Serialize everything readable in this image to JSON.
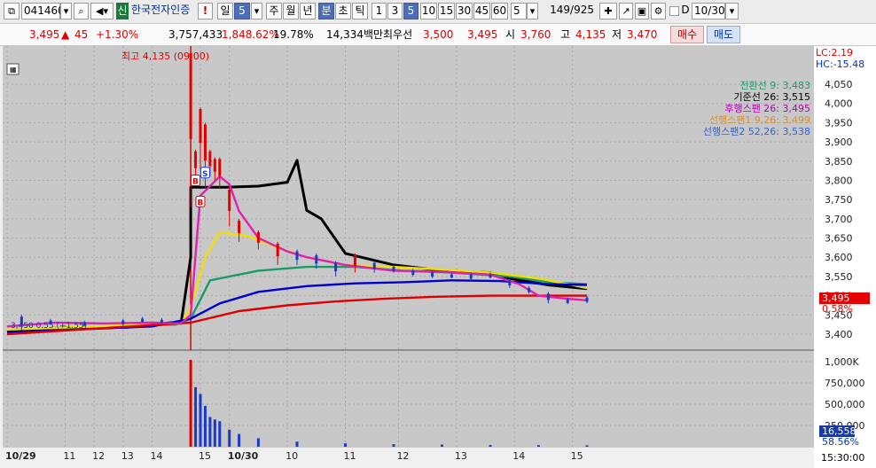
{
  "toolbar": {
    "code": "041460",
    "market_badge": "신",
    "stock_name": "한국전자인증",
    "alert_label": "!",
    "period_day": "일",
    "period_num": "5",
    "periods": [
      "주",
      "월",
      "년",
      "분",
      "초",
      "틱"
    ],
    "intervals": [
      "1",
      "3",
      "5",
      "10",
      "15",
      "30",
      "45",
      "60"
    ],
    "count_value": "5",
    "page_counter": "149/925",
    "d_label": "D",
    "date_value": "10/30",
    "colors": {
      "selected": "#4a6fb8"
    }
  },
  "info": {
    "price": "3,495",
    "change": "45",
    "change_pct": "+1.30%",
    "volume": "3,757,433",
    "vol_ratio": "1,848.62%",
    "turnover": "19.78%",
    "amount": "14,334백만",
    "bid_label": "최우선",
    "bid_price": "3,500",
    "ask_price": "3,495",
    "open_label": "시",
    "open": "3,760",
    "high_label": "고",
    "high": "4,135",
    "low_label": "저",
    "low": "3,470",
    "buy_label": "매수",
    "sell_label": "매도"
  },
  "chart": {
    "lc_label": "LC:2.19",
    "hc_label": "HC:-15.48",
    "high_annotation": "최고 4,135 (09:00)",
    "legend": [
      {
        "label": "전환선 9: 3,483",
        "color": "#1a9c66"
      },
      {
        "label": "기준선 26: 3,515",
        "color": "#000000"
      },
      {
        "label": "후행스팬 26: 3,495",
        "color": "#b000b0"
      },
      {
        "label": "선행스팬1 9,26: 3,499",
        "color": "#d89030"
      },
      {
        "label": "선행스팬2 52,26: 3,538",
        "color": "#3060d0"
      }
    ],
    "price_ticks": [
      "4,050",
      "4,000",
      "3,950",
      "3,900",
      "3,850",
      "3,800",
      "3,750",
      "3,700",
      "3,650",
      "3,600",
      "3,550",
      "3,500",
      "3,450",
      "3,400"
    ],
    "current_price_tag": "3,495",
    "current_pct_tag": "0.58%",
    "volume_ticks": [
      "1,000K",
      "750,000",
      "500,000",
      "250,000"
    ],
    "current_volume_tag": "16,558",
    "current_volume_pct": "58.56%",
    "x_labels": [
      {
        "label": "10/29"
      },
      {
        "label": "11"
      },
      {
        "label": "12"
      },
      {
        "label": "13"
      },
      {
        "label": "14"
      },
      {
        "label": "15"
      },
      {
        "label": "10/30"
      },
      {
        "label": "10"
      },
      {
        "label": "11"
      },
      {
        "label": "12"
      },
      {
        "label": "13"
      },
      {
        "label": "14"
      },
      {
        "label": "15"
      }
    ],
    "time_label": "15:30:00",
    "signals": [
      {
        "type": "B"
      },
      {
        "type": "S"
      },
      {
        "type": "B"
      }
    ],
    "small_note": "3,450 0.55 (+1.55)"
  },
  "chart_data": {
    "type": "line",
    "title": "",
    "ylim": [
      3380,
      4135
    ],
    "series": [
      {
        "name": "기준선",
        "color": "#000000",
        "points": [
          [
            0,
            3410
          ],
          [
            12,
            3417
          ],
          [
            25,
            3418
          ],
          [
            30,
            3425
          ],
          [
            34,
            3430
          ],
          [
            36,
            3428
          ],
          [
            38,
            3600
          ],
          [
            38,
            3782
          ],
          [
            45,
            3782
          ],
          [
            52,
            3785
          ],
          [
            58,
            3795
          ],
          [
            60,
            3852
          ],
          [
            62,
            3722
          ],
          [
            65,
            3700
          ],
          [
            70,
            3610
          ],
          [
            80,
            3580
          ],
          [
            90,
            3565
          ],
          [
            100,
            3560
          ],
          [
            104,
            3545
          ],
          [
            112,
            3528
          ],
          [
            120,
            3518
          ]
        ]
      },
      {
        "name": "전환선",
        "color": "#1a9c66",
        "points": [
          [
            0,
            3412
          ],
          [
            20,
            3420
          ],
          [
            35,
            3425
          ],
          [
            38,
            3440
          ],
          [
            42,
            3540
          ],
          [
            52,
            3565
          ],
          [
            62,
            3575
          ],
          [
            72,
            3575
          ],
          [
            82,
            3565
          ],
          [
            92,
            3560
          ],
          [
            104,
            3550
          ],
          [
            112,
            3535
          ],
          [
            120,
            3530
          ]
        ]
      },
      {
        "name": "Yellow",
        "color": "#f0e000",
        "points": [
          [
            0,
            3412
          ],
          [
            36,
            3428
          ],
          [
            38,
            3470
          ],
          [
            41,
            3600
          ],
          [
            44,
            3665
          ],
          [
            50,
            3655
          ],
          [
            56,
            3625
          ],
          [
            62,
            3600
          ],
          [
            70,
            3580
          ],
          [
            80,
            3575
          ],
          [
            90,
            3568
          ],
          [
            100,
            3560
          ],
          [
            110,
            3545
          ],
          [
            120,
            3520
          ]
        ]
      },
      {
        "name": "Blue",
        "color": "#0000cc",
        "points": [
          [
            0,
            3405
          ],
          [
            30,
            3420
          ],
          [
            38,
            3440
          ],
          [
            44,
            3480
          ],
          [
            52,
            3510
          ],
          [
            62,
            3525
          ],
          [
            72,
            3532
          ],
          [
            82,
            3535
          ],
          [
            92,
            3540
          ],
          [
            102,
            3538
          ],
          [
            112,
            3530
          ],
          [
            120,
            3528
          ]
        ]
      },
      {
        "name": "Red",
        "color": "#dd0000",
        "points": [
          [
            0,
            3400
          ],
          [
            38,
            3430
          ],
          [
            48,
            3460
          ],
          [
            58,
            3475
          ],
          [
            68,
            3485
          ],
          [
            78,
            3492
          ],
          [
            88,
            3497
          ],
          [
            100,
            3500
          ],
          [
            110,
            3500
          ],
          [
            120,
            3500
          ]
        ]
      },
      {
        "name": "후행스팬",
        "color": "#e020b0",
        "points": [
          [
            0,
            3420
          ],
          [
            10,
            3430
          ],
          [
            20,
            3428
          ],
          [
            30,
            3430
          ],
          [
            36,
            3428
          ],
          [
            38,
            3450
          ],
          [
            40,
            3760
          ],
          [
            44,
            3810
          ],
          [
            46,
            3790
          ],
          [
            48,
            3720
          ],
          [
            52,
            3650
          ],
          [
            58,
            3615
          ],
          [
            62,
            3600
          ],
          [
            66,
            3590
          ],
          [
            70,
            3580
          ],
          [
            80,
            3565
          ],
          [
            90,
            3562
          ],
          [
            100,
            3555
          ],
          [
            106,
            3530
          ],
          [
            110,
            3500
          ],
          [
            116,
            3492
          ],
          [
            120,
            3488
          ]
        ]
      }
    ],
    "candles": [
      [
        3,
        3410,
        3450
      ],
      [
        9,
        3425,
        3440
      ],
      [
        16,
        3420,
        3435
      ],
      [
        24,
        3422,
        3440
      ],
      [
        28,
        3430,
        3445
      ],
      [
        32,
        3428,
        3442
      ],
      [
        38,
        3730,
        4135
      ],
      [
        39,
        3800,
        3880
      ],
      [
        40,
        3830,
        3990
      ],
      [
        41,
        3780,
        3950
      ],
      [
        42,
        3810,
        3880
      ],
      [
        43,
        3800,
        3860
      ],
      [
        44,
        3780,
        3860
      ],
      [
        46,
        3680,
        3780
      ],
      [
        48,
        3640,
        3700
      ],
      [
        52,
        3620,
        3670
      ],
      [
        56,
        3580,
        3640
      ],
      [
        60,
        3580,
        3620
      ],
      [
        64,
        3570,
        3610
      ],
      [
        68,
        3550,
        3590
      ],
      [
        72,
        3560,
        3610
      ],
      [
        76,
        3560,
        3590
      ],
      [
        80,
        3560,
        3580
      ],
      [
        84,
        3550,
        3570
      ],
      [
        88,
        3545,
        3565
      ],
      [
        92,
        3545,
        3560
      ],
      [
        96,
        3540,
        3560
      ],
      [
        100,
        3545,
        3560
      ],
      [
        104,
        3520,
        3545
      ],
      [
        108,
        3505,
        3525
      ],
      [
        112,
        3480,
        3510
      ],
      [
        116,
        3478,
        3495
      ],
      [
        120,
        3480,
        3500
      ]
    ],
    "volume": [
      [
        38,
        1020000
      ],
      [
        39,
        700000
      ],
      [
        40,
        620000
      ],
      [
        41,
        480000
      ],
      [
        42,
        350000
      ],
      [
        43,
        320000
      ],
      [
        44,
        300000
      ],
      [
        46,
        200000
      ],
      [
        48,
        150000
      ],
      [
        52,
        100000
      ],
      [
        60,
        60000
      ],
      [
        70,
        40000
      ],
      [
        80,
        30000
      ],
      [
        90,
        25000
      ],
      [
        100,
        20000
      ],
      [
        110,
        18000
      ],
      [
        120,
        16558
      ]
    ]
  }
}
